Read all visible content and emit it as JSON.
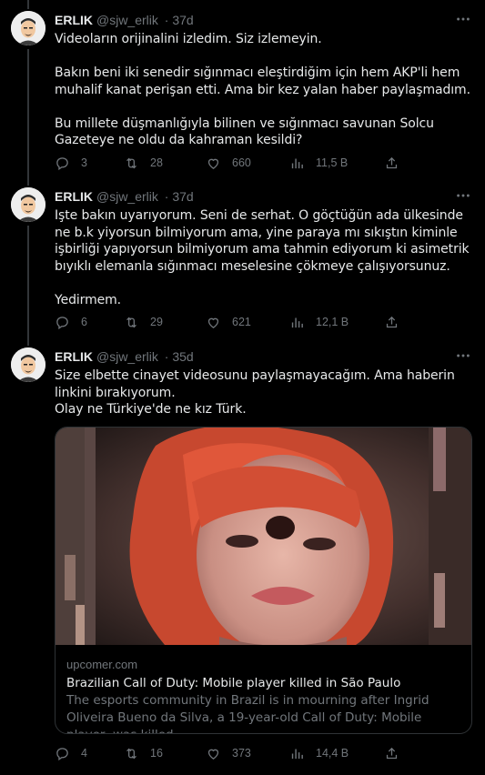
{
  "author": {
    "name": "ERLIK",
    "handle": "@sjw_erlik"
  },
  "tweets": [
    {
      "time": "· 37d",
      "text": "Videoların orijinalini izledim. Siz izlemeyin.\n\nBakın beni iki senedir sığınmacı eleştirdiğim için hem AKP'li hem muhalif kanat perişan etti. Ama bir kez yalan haber paylaşmadım.\n\nBu millete düşmanlığıyla bilinen ve sığınmacı savunan Solcu Gazeteye ne oldu da kahraman kesildi?",
      "replies": "3",
      "retweets": "28",
      "likes": "660",
      "views": "11,5 B"
    },
    {
      "time": "· 37d",
      "text": "Işte bakın uyarıyorum. Seni de serhat. O göçtüğün ada ülkesinde ne b.k yiyorsun bilmiyorum ama, yine paraya mı sıkıştın kiminle işbirliği yapıyorsun bilmiyorum ama tahmin ediyorum ki asimetrik bıyıklı elemanla sığınmacı meselesine çökmeye çalışıyorsunuz.\n\nYedirmem.",
      "replies": "6",
      "retweets": "29",
      "likes": "621",
      "views": "12,1 B"
    },
    {
      "time": "· 35d",
      "text": "Size elbette cinayet videosunu paylaşmayacağım. Ama haberin linkini bırakıyorum.\nOlay ne Türkiye'de ne kız Türk.",
      "replies": "4",
      "retweets": "16",
      "likes": "373",
      "views": "14,4 B",
      "card": {
        "domain": "upcomer.com",
        "title": "Brazilian Call of Duty: Mobile player killed in São Paulo",
        "description": "The esports community in Brazil is in mourning after Ingrid Oliveira Bueno da Silva, a 19-year-old Call of Duty: Mobile player, was killed."
      }
    }
  ],
  "icons": {
    "more": "more-icon",
    "reply": "reply-icon",
    "retweet": "retweet-icon",
    "like": "like-icon",
    "views": "views-icon",
    "share": "share-icon"
  },
  "colors": {
    "background": "#000000",
    "text": "#e7e9ea",
    "secondary": "#71767b",
    "border": "#2f3336"
  }
}
